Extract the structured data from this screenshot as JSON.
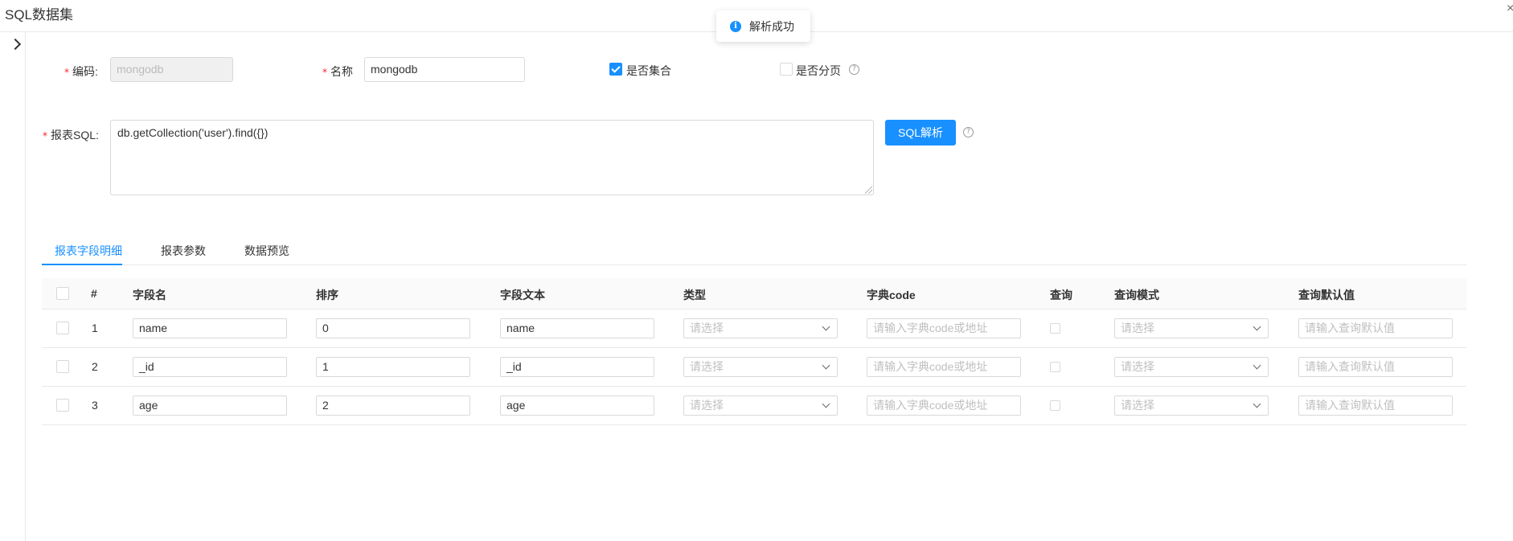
{
  "window": {
    "title": "SQL数据集",
    "close_glyph": "×"
  },
  "toast": {
    "icon": "info-icon",
    "glyph": "i",
    "text": "解析成功"
  },
  "form": {
    "code": {
      "label": "编码:",
      "value": "mongodb"
    },
    "name": {
      "label": "名称",
      "value": "mongodb"
    },
    "is_collection": {
      "label": "是否集合",
      "checked": true
    },
    "is_paged": {
      "label": "是否分页",
      "checked": false
    },
    "sql": {
      "label": "报表SQL:",
      "value": "db.getCollection('user').find({})"
    },
    "parse_button": "SQL解析",
    "required_mark": "*",
    "help_glyph": "?"
  },
  "tabs": [
    "报表字段明细",
    "报表参数",
    "数据预览"
  ],
  "table": {
    "headers": [
      "#",
      "字段名",
      "排序",
      "字段文本",
      "类型",
      "字典code",
      "查询",
      "查询模式",
      "查询默认值"
    ],
    "placeholders": {
      "type": "请选择",
      "dict_code": "请输入字典code或地址",
      "query_mode": "请选择",
      "query_default": "请输入查询默认值"
    },
    "rows": [
      {
        "index": "1",
        "field_name": "name",
        "order": "0",
        "field_text": "name"
      },
      {
        "index": "2",
        "field_name": "_id",
        "order": "1",
        "field_text": "_id"
      },
      {
        "index": "3",
        "field_name": "age",
        "order": "2",
        "field_text": "age"
      }
    ]
  },
  "colors": {
    "primary": "#1890ff",
    "required": "#f5222d",
    "border": "#d9d9d9"
  }
}
